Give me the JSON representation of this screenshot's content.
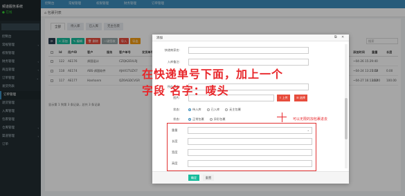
{
  "sidebar": {
    "site_name": "频道服务系统",
    "status": "● 在线",
    "items": [
      {
        "label": "控制台"
      },
      {
        "label": "常规管理"
      },
      {
        "label": "权限管理"
      },
      {
        "label": "财务管理"
      },
      {
        "label": "商品管理"
      },
      {
        "label": "订单管理"
      },
      {
        "label": "发货列表"
      },
      {
        "label": "订单管理"
      },
      {
        "label": "退货管理"
      },
      {
        "label": "入库管理"
      },
      {
        "label": "包裹管理"
      },
      {
        "label": "仓库管理"
      },
      {
        "label": "渠道管理"
      },
      {
        "label": "订单"
      }
    ]
  },
  "topbar": {
    "menus": [
      "控制台",
      "常规管理",
      "权限管理",
      "财务管理",
      "订单管理"
    ]
  },
  "breadcrumb": "包裹列表",
  "page": {
    "tabs": [
      {
        "label": "全部"
      },
      {
        "label": "待入库"
      },
      {
        "label": "已入库"
      },
      {
        "label": "无主包裹"
      }
    ],
    "toolbar": [
      {
        "label": "⟳",
        "color": "#2c3e50"
      },
      {
        "label": "+ 添加",
        "color": "#18bc9c"
      },
      {
        "label": "✎ 编辑",
        "color": "#18bc9c"
      },
      {
        "label": "🗑 删除",
        "color": "#e74c3c"
      },
      {
        "label": "一键签收",
        "color": "#95a5a6"
      },
      {
        "label": "导入",
        "color": "#e74c3c"
      },
      {
        "label": "导出",
        "color": "#f39c12"
      }
    ],
    "search_placeholder": "搜索",
    "columns": [
      "Id",
      "用户ID",
      "客户",
      "服务",
      "客户单号",
      "发货单号",
      "添加时间",
      "重量",
      "长度"
    ],
    "rows": [
      [
        "122",
        "AE176",
        "邦国设计",
        "",
        "CZQK2EVLRJ",
        "",
        "~04-26 15:29:40",
        "",
        ""
      ],
      [
        "118",
        "AE174",
        "ABS-邦国软件",
        "",
        "AJHX1TUZX7",
        "",
        "~04-24 13:21:12",
        "2.60",
        "0.00"
      ],
      [
        "117",
        "AE177",
        "Hanhanm",
        "",
        "QZ6AGDCVGR",
        "",
        "~04-27 16:13:32",
        "10.00",
        "100.00"
      ]
    ],
    "footer": "显示第 1 到第 3 条记录，总共 3 条记录"
  },
  "modal": {
    "title": "添加",
    "fields": [
      {
        "label": "快递商家名:",
        "value": ""
      },
      {
        "label": "入库备注:",
        "value": ""
      },
      {
        "label": "所在仓库:",
        "value": ""
      },
      {
        "label": "图片:",
        "value": ""
      }
    ],
    "upload_label": "⇪ 上传",
    "choose_label": "☰ 选择",
    "status_label": "状态:",
    "status_options": [
      {
        "label": "待入库",
        "checked": true
      },
      {
        "label": "已入库",
        "checked": false
      },
      {
        "label": "无主包裹",
        "checked": false
      }
    ],
    "type_label": "状态:",
    "type_options": [
      {
        "label": "正常包裹",
        "checked": true
      },
      {
        "label": "异形包裹",
        "checked": false
      }
    ],
    "sub_fields": [
      {
        "label": "重量"
      },
      {
        "label": "长度"
      },
      {
        "label": "宽度"
      },
      {
        "label": "高度"
      }
    ],
    "sub_select_value": "",
    "ok_label": "确定",
    "reset_label": "重置"
  },
  "annotations": {
    "main_line1": "在快递单号下面，加上一个",
    "main_line2": "字段   名字：唛头",
    "side_note": "可以无限的加包裹进去"
  },
  "colors": {
    "accent": "#3c8dbc",
    "annotation": "#e8262a",
    "success": "#18bc9c"
  }
}
